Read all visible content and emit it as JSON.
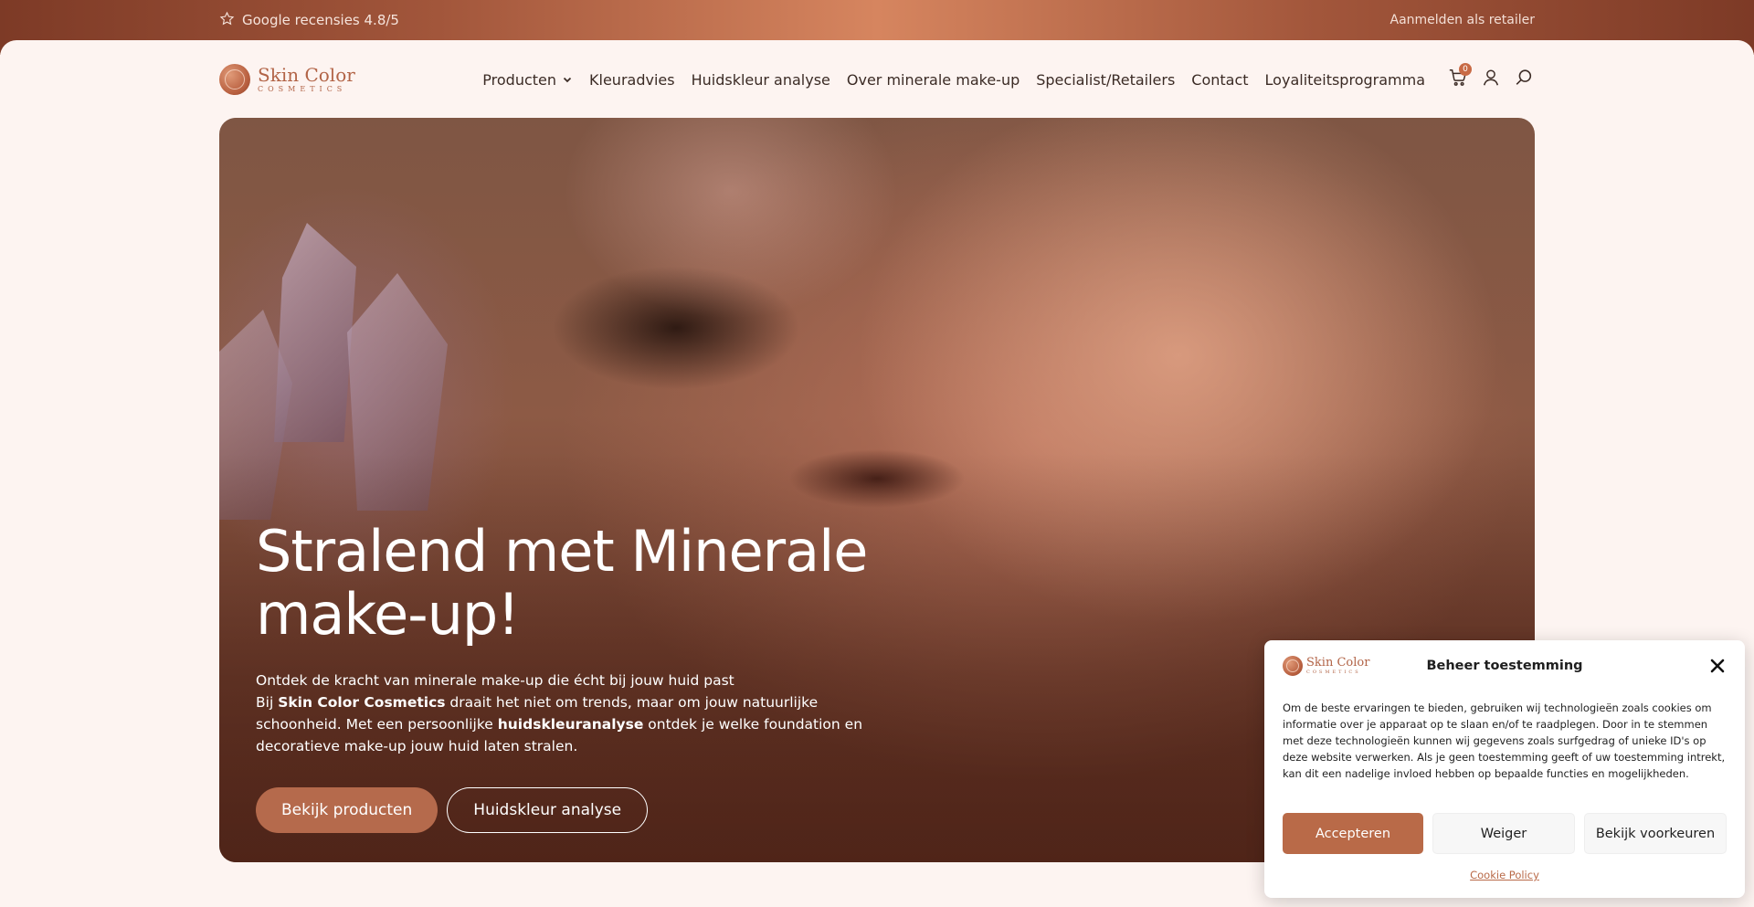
{
  "topbar": {
    "review_text": "Google recensies 4.8/5",
    "retailer_link": "Aanmelden als retailer"
  },
  "logo": {
    "name": "Skin Color",
    "sub": "COSMETICS"
  },
  "nav": {
    "items": [
      {
        "label": "Producten"
      },
      {
        "label": "Kleuradvies"
      },
      {
        "label": "Huidskleur analyse"
      },
      {
        "label": "Over minerale make-up"
      },
      {
        "label": "Specialist/Retailers"
      },
      {
        "label": "Contact"
      },
      {
        "label": "Loyaliteitsprogramma"
      }
    ],
    "cart_count": "0"
  },
  "hero": {
    "title_line1": "Stralend met Minerale",
    "title_line2": "make-up!",
    "line1": "Ontdek de kracht van minerale make-up die écht bij jouw huid past",
    "p_before": "Bij ",
    "p_bold1": "Skin Color Cosmetics",
    "p_mid": " draait het niet om trends, maar om jouw natuurlijke schoonheid. Met een persoonlijke ",
    "p_bold2": "huidskleuranalyse",
    "p_after": " ontdek je welke foundation en decoratieve make-up jouw huid laten stralen.",
    "btn_primary": "Bekijk producten",
    "btn_secondary": "Huidskleur analyse"
  },
  "cookie": {
    "title": "Beheer toestemming",
    "body": "Om de beste ervaringen te bieden, gebruiken wij technologieën zoals cookies om informatie over je apparaat op te slaan en/of te raadplegen. Door in te stemmen met deze technologieën kunnen wij gegevens zoals surfgedrag of unieke ID's op deze website verwerken. Als je geen toestemming geeft of uw toestemming intrekt, kan dit een nadelige invloed hebben op bepaalde functies en mogelijkheden.",
    "accept": "Accepteren",
    "deny": "Weiger",
    "preferences": "Bekijk voorkeuren",
    "policy": "Cookie Policy"
  },
  "colors": {
    "accent": "#b96a48",
    "background": "#fdf4f1",
    "topbar": "#a2563b"
  }
}
